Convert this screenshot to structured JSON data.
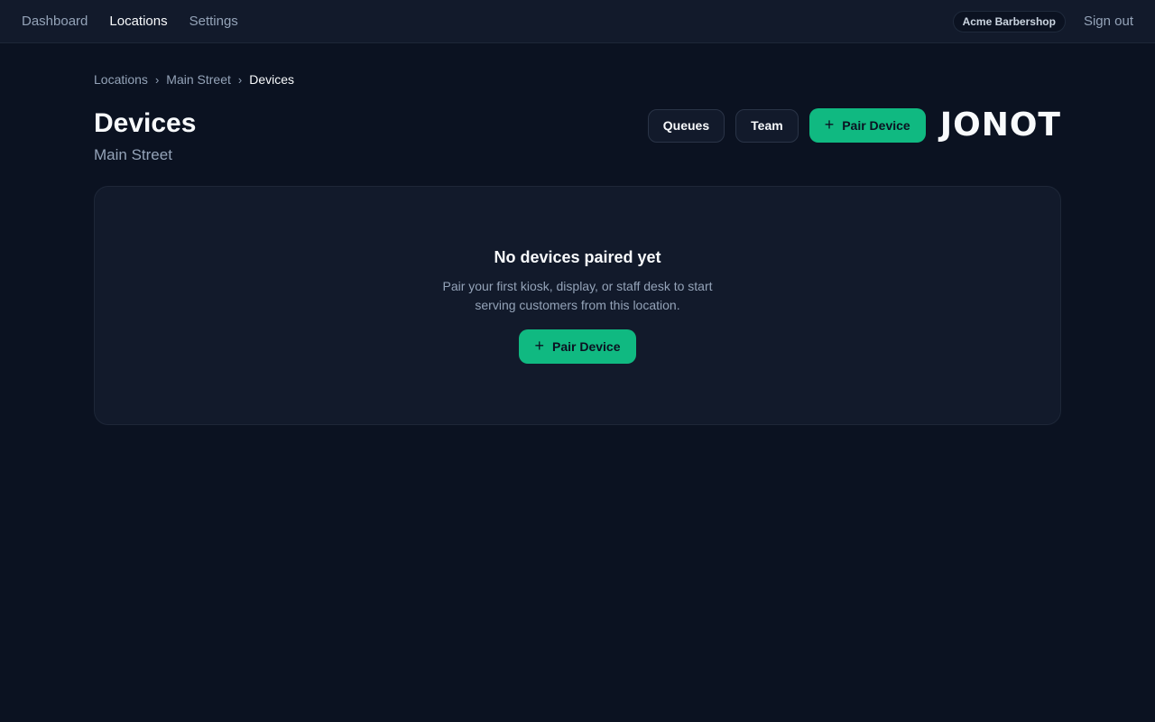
{
  "nav": {
    "links": [
      "Dashboard",
      "Locations",
      "Settings"
    ],
    "active": "Locations",
    "org_name": "Acme Barbershop",
    "sign_out": "Sign out"
  },
  "breadcrumb": [
    "Locations",
    "Main Street",
    "Devices"
  ],
  "breadcrumb_separator": "›",
  "page": {
    "title": "Devices",
    "subtitle": "Main Street"
  },
  "actions": {
    "queues": "Queues",
    "team": "Team",
    "pair_device": "Pair Device",
    "plus_icon": "plus-icon"
  },
  "logo": {
    "text": "JONOT"
  },
  "empty_state": {
    "title": "No devices paired yet",
    "description": "Pair your first kiosk, display, or staff desk to start serving customers from this location.",
    "button": "Pair Device"
  },
  "colors": {
    "background": "#0b1221",
    "surface": "#121a2b",
    "accent": "#10b981",
    "muted_text": "#94a3b8"
  }
}
